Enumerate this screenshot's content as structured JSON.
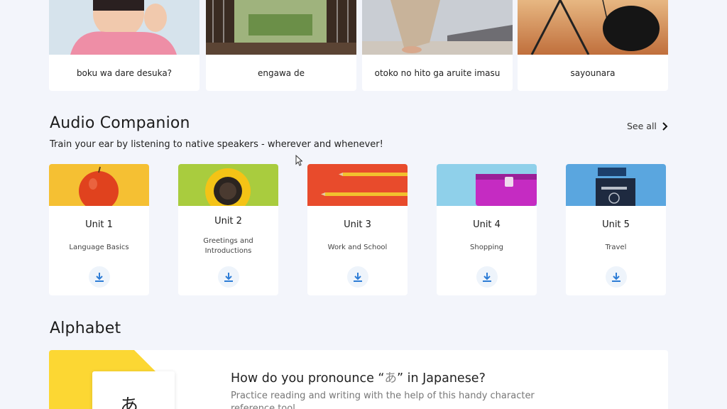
{
  "stories": [
    {
      "label": "boku wa dare desuka?"
    },
    {
      "label": "engawa de"
    },
    {
      "label": "otoko no hito ga aruite imasu"
    },
    {
      "label": "sayounara"
    }
  ],
  "audio_companion": {
    "title": "Audio Companion",
    "subtitle": "Train your ear by listening to native speakers - wherever and whenever!",
    "see_all": "See all",
    "units": [
      {
        "title": "Unit 1",
        "desc": "Language Basics",
        "icon": "apple-icon",
        "color": "#f5c033"
      },
      {
        "title": "Unit 2",
        "desc": "Greetings and Introductions",
        "icon": "coffee-cup-icon",
        "color": "#a9cc3e"
      },
      {
        "title": "Unit 3",
        "desc": "Work and School",
        "icon": "pencils-icon",
        "color": "#e84b2c"
      },
      {
        "title": "Unit 4",
        "desc": "Shopping",
        "icon": "wallet-icon",
        "color": "#8fd0ea"
      },
      {
        "title": "Unit 5",
        "desc": "Travel",
        "icon": "passport-icon",
        "color": "#5aa6df"
      }
    ]
  },
  "alphabet": {
    "title": "Alphabet",
    "question_pre": "How do you pronounce “",
    "question_kana": "あ",
    "question_post": "” in Japanese?",
    "description": "Practice reading and writing with the help of this handy character reference tool",
    "tile_char": "あ"
  },
  "colors": {
    "accent": "#2e7dd6",
    "background": "#f3f5fb",
    "alphabet_yellow": "#fcd733"
  }
}
